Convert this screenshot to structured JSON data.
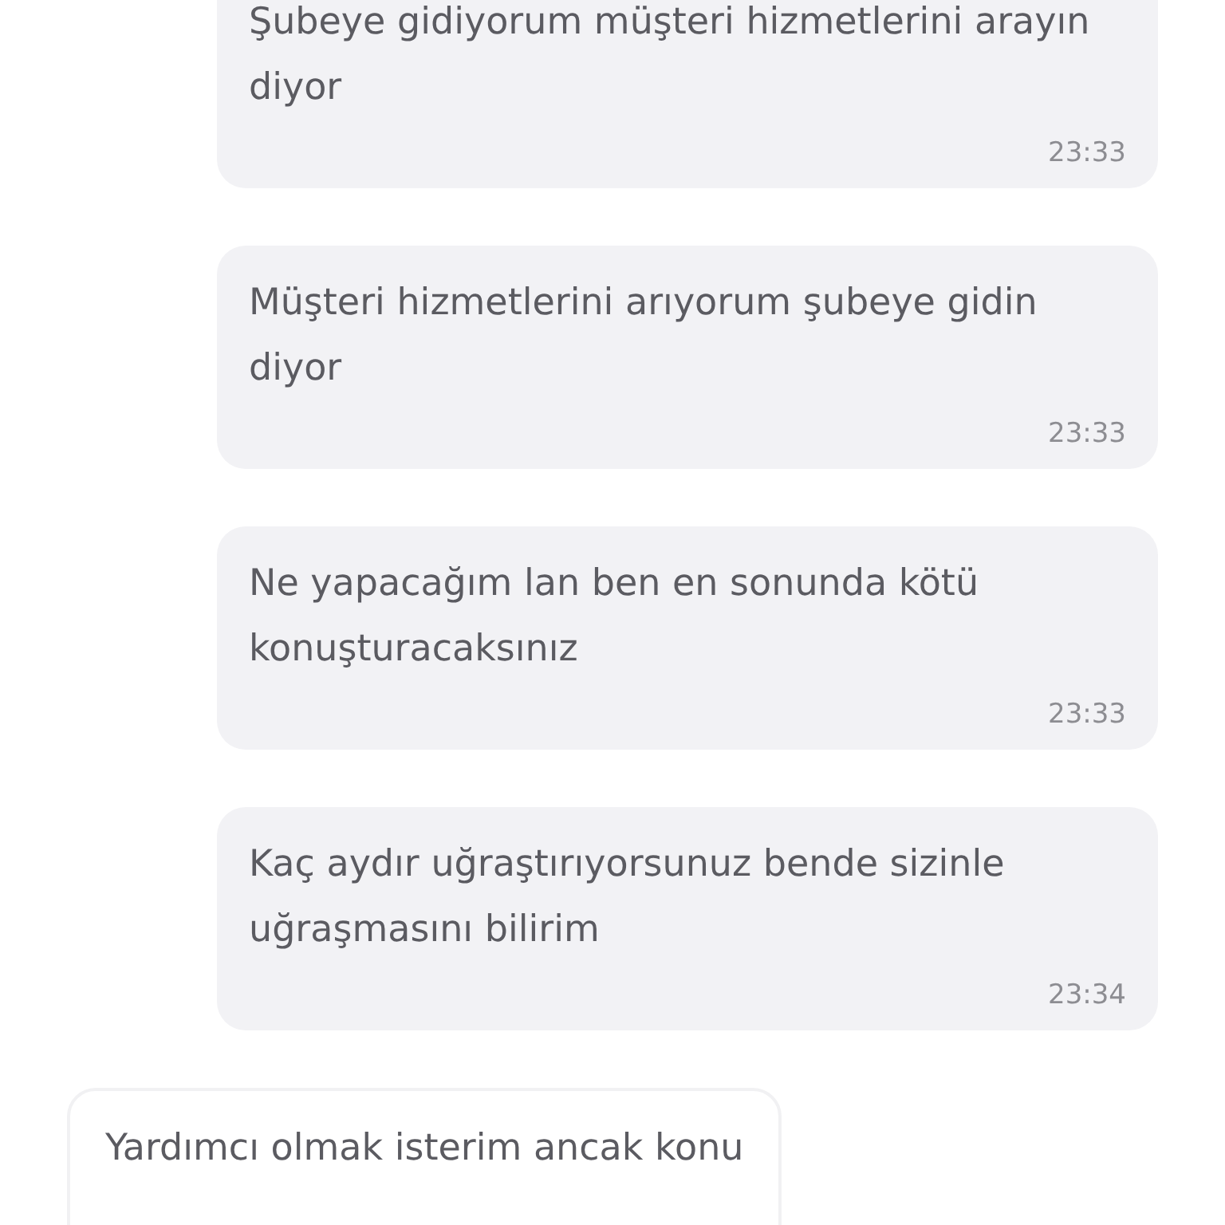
{
  "messages": [
    {
      "kind": "sent",
      "text": "Şubeye gidiyorum müşteri hizmetlerini arayın diyor",
      "time": "23:33"
    },
    {
      "kind": "sent",
      "text": "Müşteri hizmetlerini arıyorum şubeye gidin diyor",
      "time": "23:33"
    },
    {
      "kind": "sent",
      "text": "Ne yapacağım lan ben en sonunda kötü konuşturacaksınız",
      "time": "23:33"
    },
    {
      "kind": "sent",
      "text": "Kaç aydır uğraştırıyorsunuz bende sizinle uğraşmasını bilirim",
      "time": "23:34"
    },
    {
      "kind": "received",
      "text": "Yardımcı olmak isterim ancak konu"
    }
  ]
}
